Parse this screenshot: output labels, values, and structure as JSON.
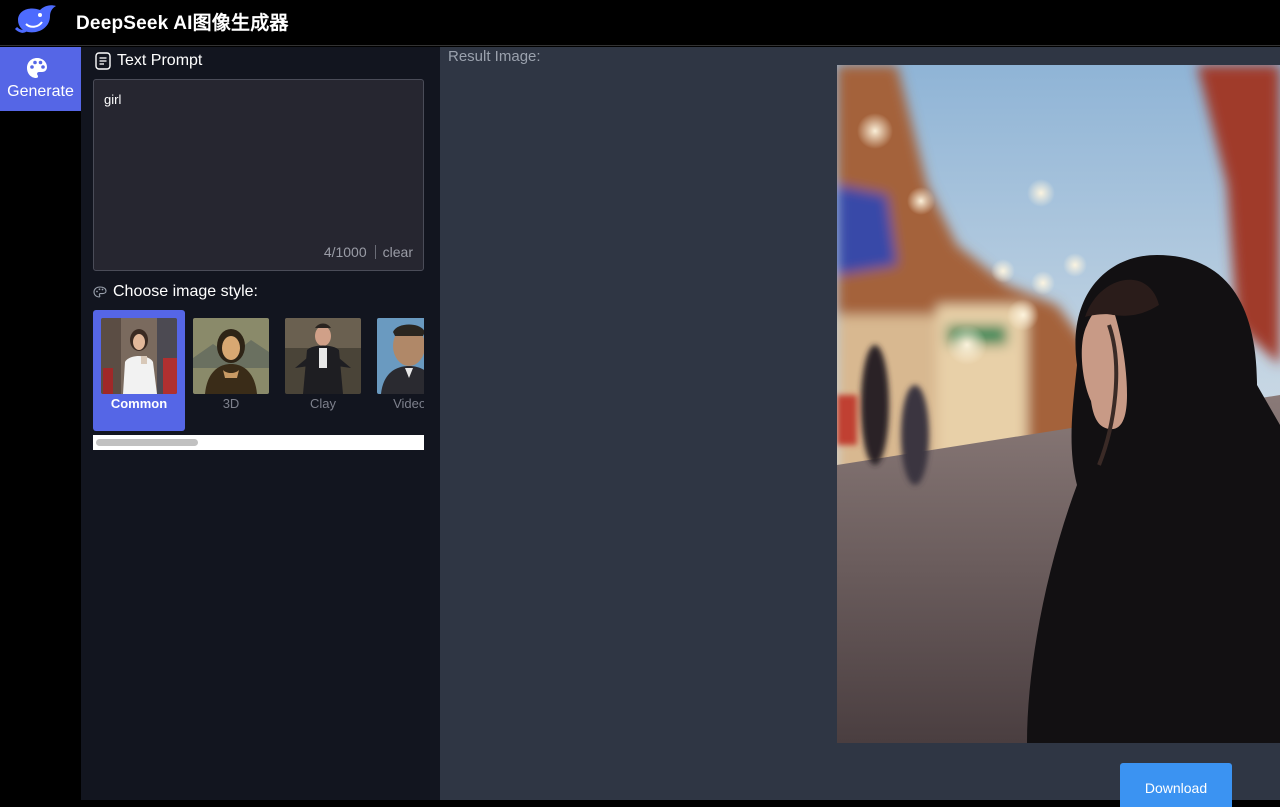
{
  "app": {
    "title": "DeepSeek AI图像生成器"
  },
  "nav": {
    "generate_label": "Generate"
  },
  "prompt": {
    "section_title": "Text Prompt",
    "value": "girl",
    "counter": "4/1000",
    "clear_label": "clear"
  },
  "styles": {
    "section_title": "Choose image style:",
    "items": [
      {
        "label": "Common",
        "selected": true
      },
      {
        "label": "3D",
        "selected": false
      },
      {
        "label": "Clay",
        "selected": false
      },
      {
        "label": "Video g",
        "selected": false
      }
    ]
  },
  "result": {
    "label": "Result Image:",
    "download_label": "Download"
  },
  "colors": {
    "accent": "#5566e6",
    "download": "#3b93f2",
    "panel_bg": "#12151f",
    "result_bg": "#2f3644"
  },
  "icons": {
    "logo": "whale-logo-icon",
    "generate": "palette-icon",
    "prompt": "document-icon",
    "styles": "palette-outline-icon"
  }
}
